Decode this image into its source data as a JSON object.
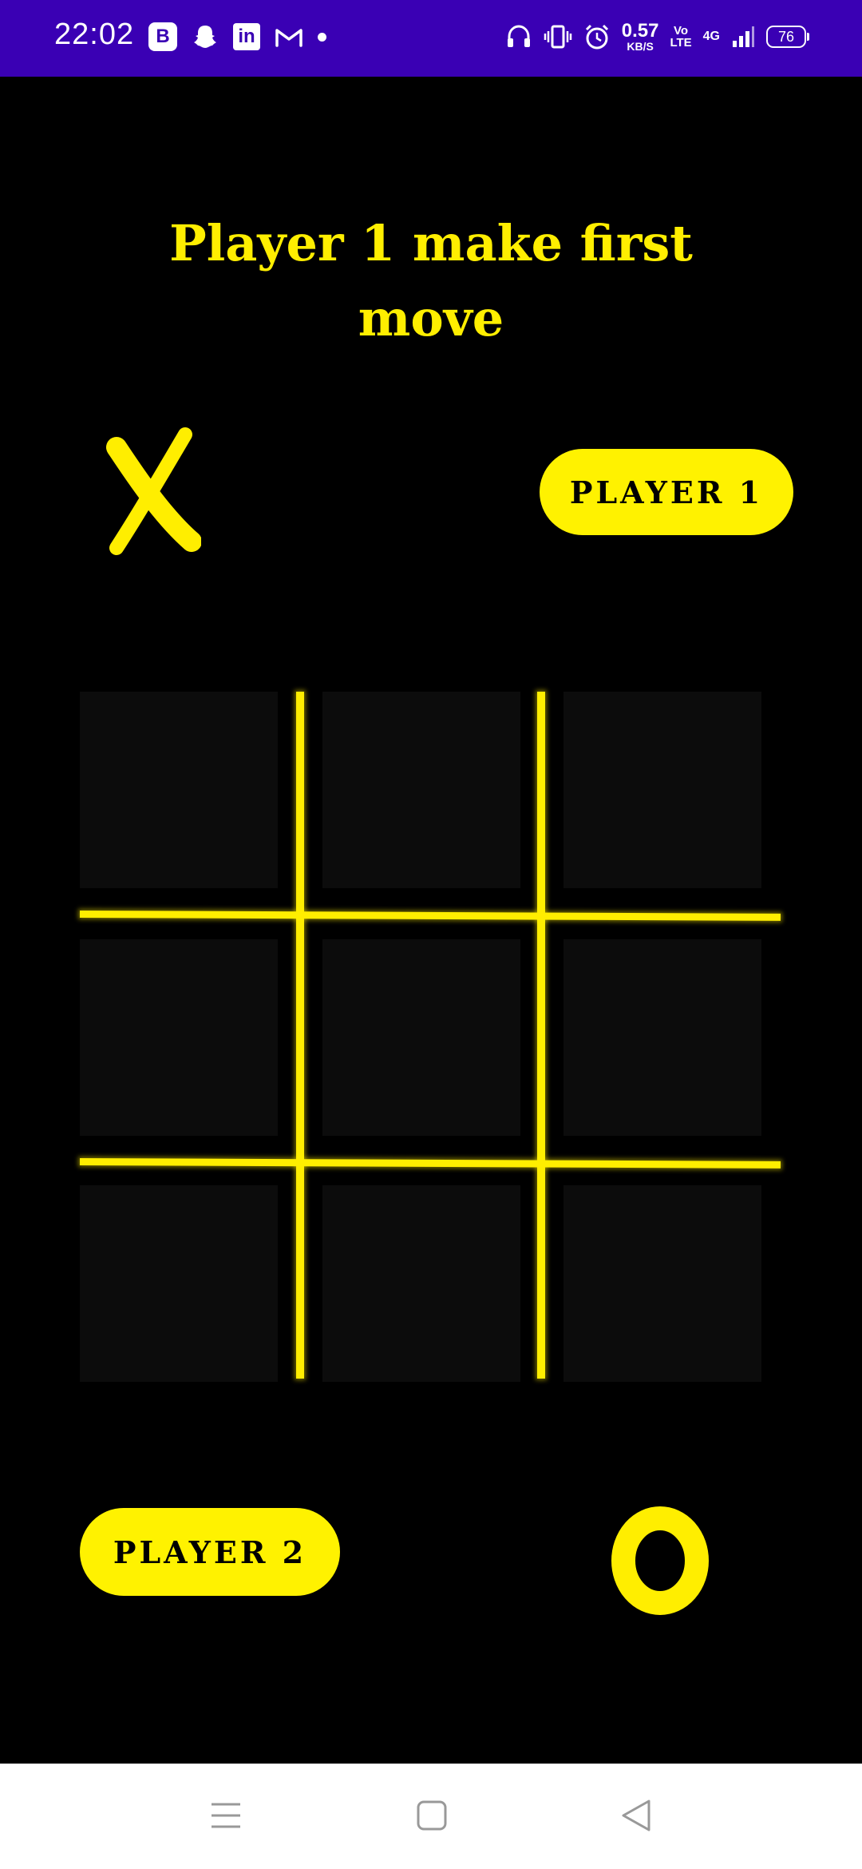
{
  "status_bar": {
    "time": "22:02",
    "left_icons": [
      "b-app-icon",
      "snapchat-icon",
      "linkedin-icon",
      "gmail-icon",
      "dot-icon"
    ],
    "b_label": "B",
    "in_label": "in",
    "speed_value": "0.57",
    "speed_unit": "KB/S",
    "volte_top": "Vo",
    "volte_bottom": "LTE",
    "network": "4G",
    "battery": "76",
    "bg_color": "#3a00b4"
  },
  "game": {
    "heading_line1": "Player 1 make first",
    "heading_line2": "move",
    "player1": {
      "label": "PLAYER 1",
      "mark": "X"
    },
    "player2": {
      "label": "PLAYER 2",
      "mark": "O"
    },
    "cells": [
      "",
      "",
      "",
      "",
      "",
      "",
      "",
      "",
      ""
    ],
    "accent_color": "#fff200",
    "cell_color": "#0c0c0c",
    "background_color": "#000000"
  },
  "nav_bar": {
    "buttons": [
      "menu-icon",
      "home-icon",
      "back-icon"
    ]
  }
}
